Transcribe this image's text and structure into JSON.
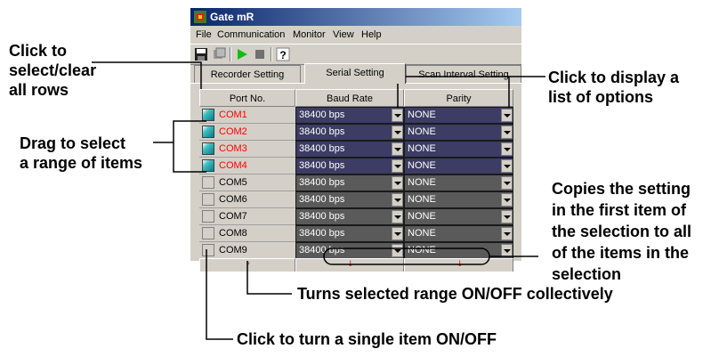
{
  "window": {
    "title": "Gate mR",
    "menu": [
      "File",
      "Communication",
      "Monitor",
      "View",
      "Help"
    ],
    "tabs": [
      {
        "label": "Recorder Setting",
        "active": false
      },
      {
        "label": "Serial Setting",
        "active": true
      },
      {
        "label": "Scan Interval Setting",
        "active": false
      }
    ],
    "columns": [
      "Port No.",
      "Baud Rate",
      "Parity"
    ],
    "rows": [
      {
        "port": "COM1",
        "baud": "38400 bps",
        "parity": "NONE",
        "on": true
      },
      {
        "port": "COM2",
        "baud": "38400 bps",
        "parity": "NONE",
        "on": true
      },
      {
        "port": "COM3",
        "baud": "38400 bps",
        "parity": "NONE",
        "on": true
      },
      {
        "port": "COM4",
        "baud": "38400 bps",
        "parity": "NONE",
        "on": true
      },
      {
        "port": "COM5",
        "baud": "38400 bps",
        "parity": "NONE",
        "on": false
      },
      {
        "port": "COM6",
        "baud": "38400 bps",
        "parity": "NONE",
        "on": false
      },
      {
        "port": "COM7",
        "baud": "38400 bps",
        "parity": "NONE",
        "on": false
      },
      {
        "port": "COM8",
        "baud": "38400 bps",
        "parity": "NONE",
        "on": false
      },
      {
        "port": "COM9",
        "baud": "38400 bps",
        "parity": "NONE",
        "on": false
      }
    ],
    "footer_symbols": [
      "⚬",
      "↓",
      "↓"
    ]
  },
  "callouts": {
    "select_all": [
      "Click to",
      "select/clear",
      "all rows"
    ],
    "drag_range": [
      "Drag to select",
      "a range of items"
    ],
    "display_list": [
      "Click to display a",
      "list of options"
    ],
    "copies": [
      "Copies the setting",
      "in the first item of",
      "the selection to all",
      "of the items in the",
      "selection"
    ],
    "turns_range": "Turns selected range ON/OFF collectively",
    "single_item": "Click to turn a single item ON/OFF"
  },
  "colors": {
    "selected_row_bg": "#3c3c64",
    "unselected_row_bg": "#5a5a5a",
    "on_port_text": "#ff0000",
    "off_port_text": "#000000"
  },
  "icons": [
    "app-icon",
    "save-icon",
    "properties-icon",
    "play-icon",
    "stop-icon",
    "help-icon",
    "dropdown-arrow-icon",
    "toggle-all-icon",
    "copy-down-icon"
  ]
}
